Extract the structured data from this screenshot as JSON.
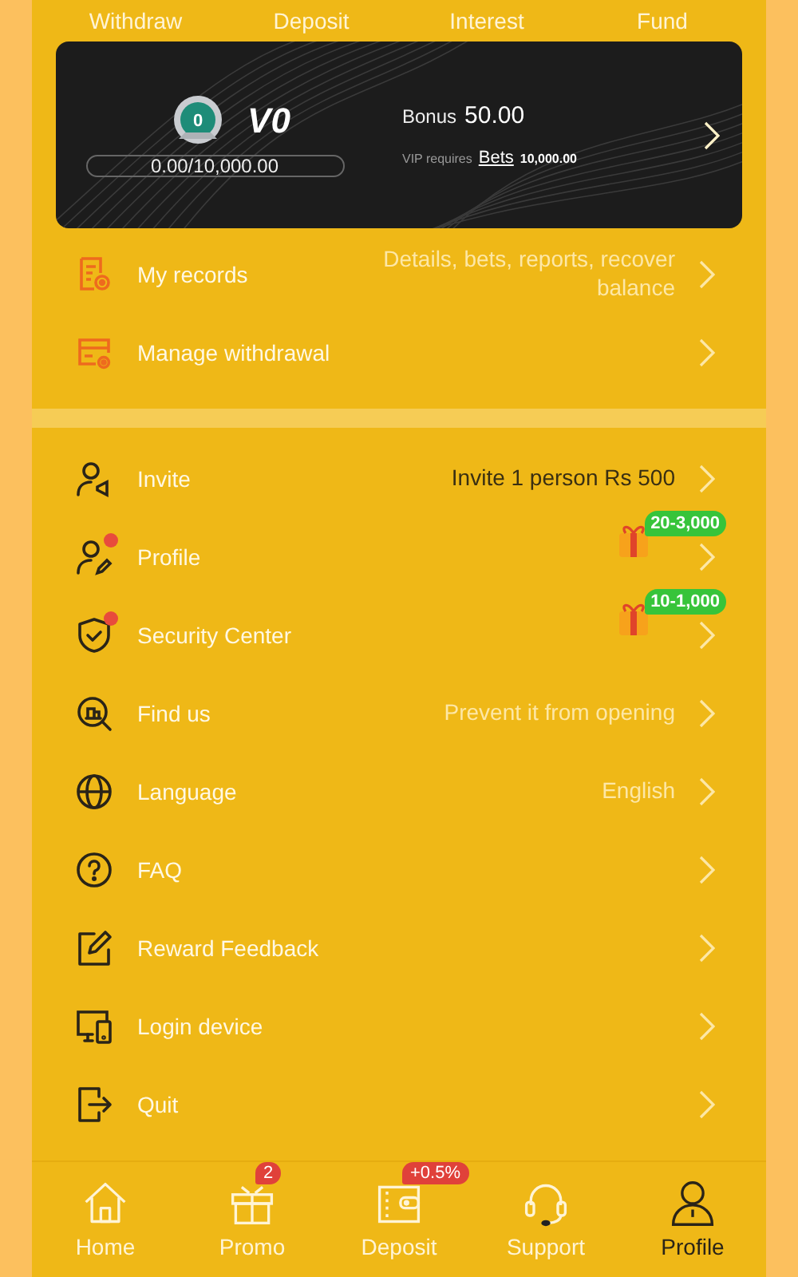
{
  "top_actions": [
    {
      "label": "Withdraw"
    },
    {
      "label": "Deposit"
    },
    {
      "label": "Interest"
    },
    {
      "label": "Fund"
    }
  ],
  "vip_card": {
    "medal": "0",
    "level_name": "V0",
    "progress_text": "0.00/10,000.00",
    "bonus_label": "Bonus",
    "bonus_value": "50.00",
    "requires_label": "VIP requires",
    "requires_link": "Bets",
    "requires_value": "10,000.00"
  },
  "sections": [
    {
      "items": [
        {
          "label": "My records",
          "value": "Details, bets, reports, recover balance",
          "color": "#fde7a6",
          "dot": false
        },
        {
          "label": "Manage withdrawal",
          "dot": false
        }
      ]
    },
    {
      "items": [
        {
          "label": "Invite",
          "value": "Invite 1 person Rs 500",
          "color": "#3a2f12",
          "dot": false
        },
        {
          "label": "Profile",
          "dot": true,
          "reward": "20-3,000"
        },
        {
          "label": "Security Center",
          "dot": true,
          "reward": "10-1,000"
        },
        {
          "label": "Find us",
          "value": "Prevent it from opening",
          "color": "#fde7a6",
          "dot": false
        },
        {
          "label": "Language",
          "value": "English",
          "color": "#fde7a6",
          "dot": false
        },
        {
          "label": "FAQ",
          "dot": false
        },
        {
          "label": "Reward Feedback",
          "dot": false
        },
        {
          "label": "Login device",
          "dot": false
        },
        {
          "label": "Quit",
          "dot": false
        }
      ]
    }
  ],
  "bottom_nav": [
    {
      "label": "Home",
      "selected": false
    },
    {
      "label": "Promo",
      "selected": false,
      "badge": "2"
    },
    {
      "label": "Deposit",
      "selected": false,
      "badge": "+0.5%"
    },
    {
      "label": "Support",
      "selected": false
    },
    {
      "label": "Profile",
      "selected": true
    }
  ]
}
